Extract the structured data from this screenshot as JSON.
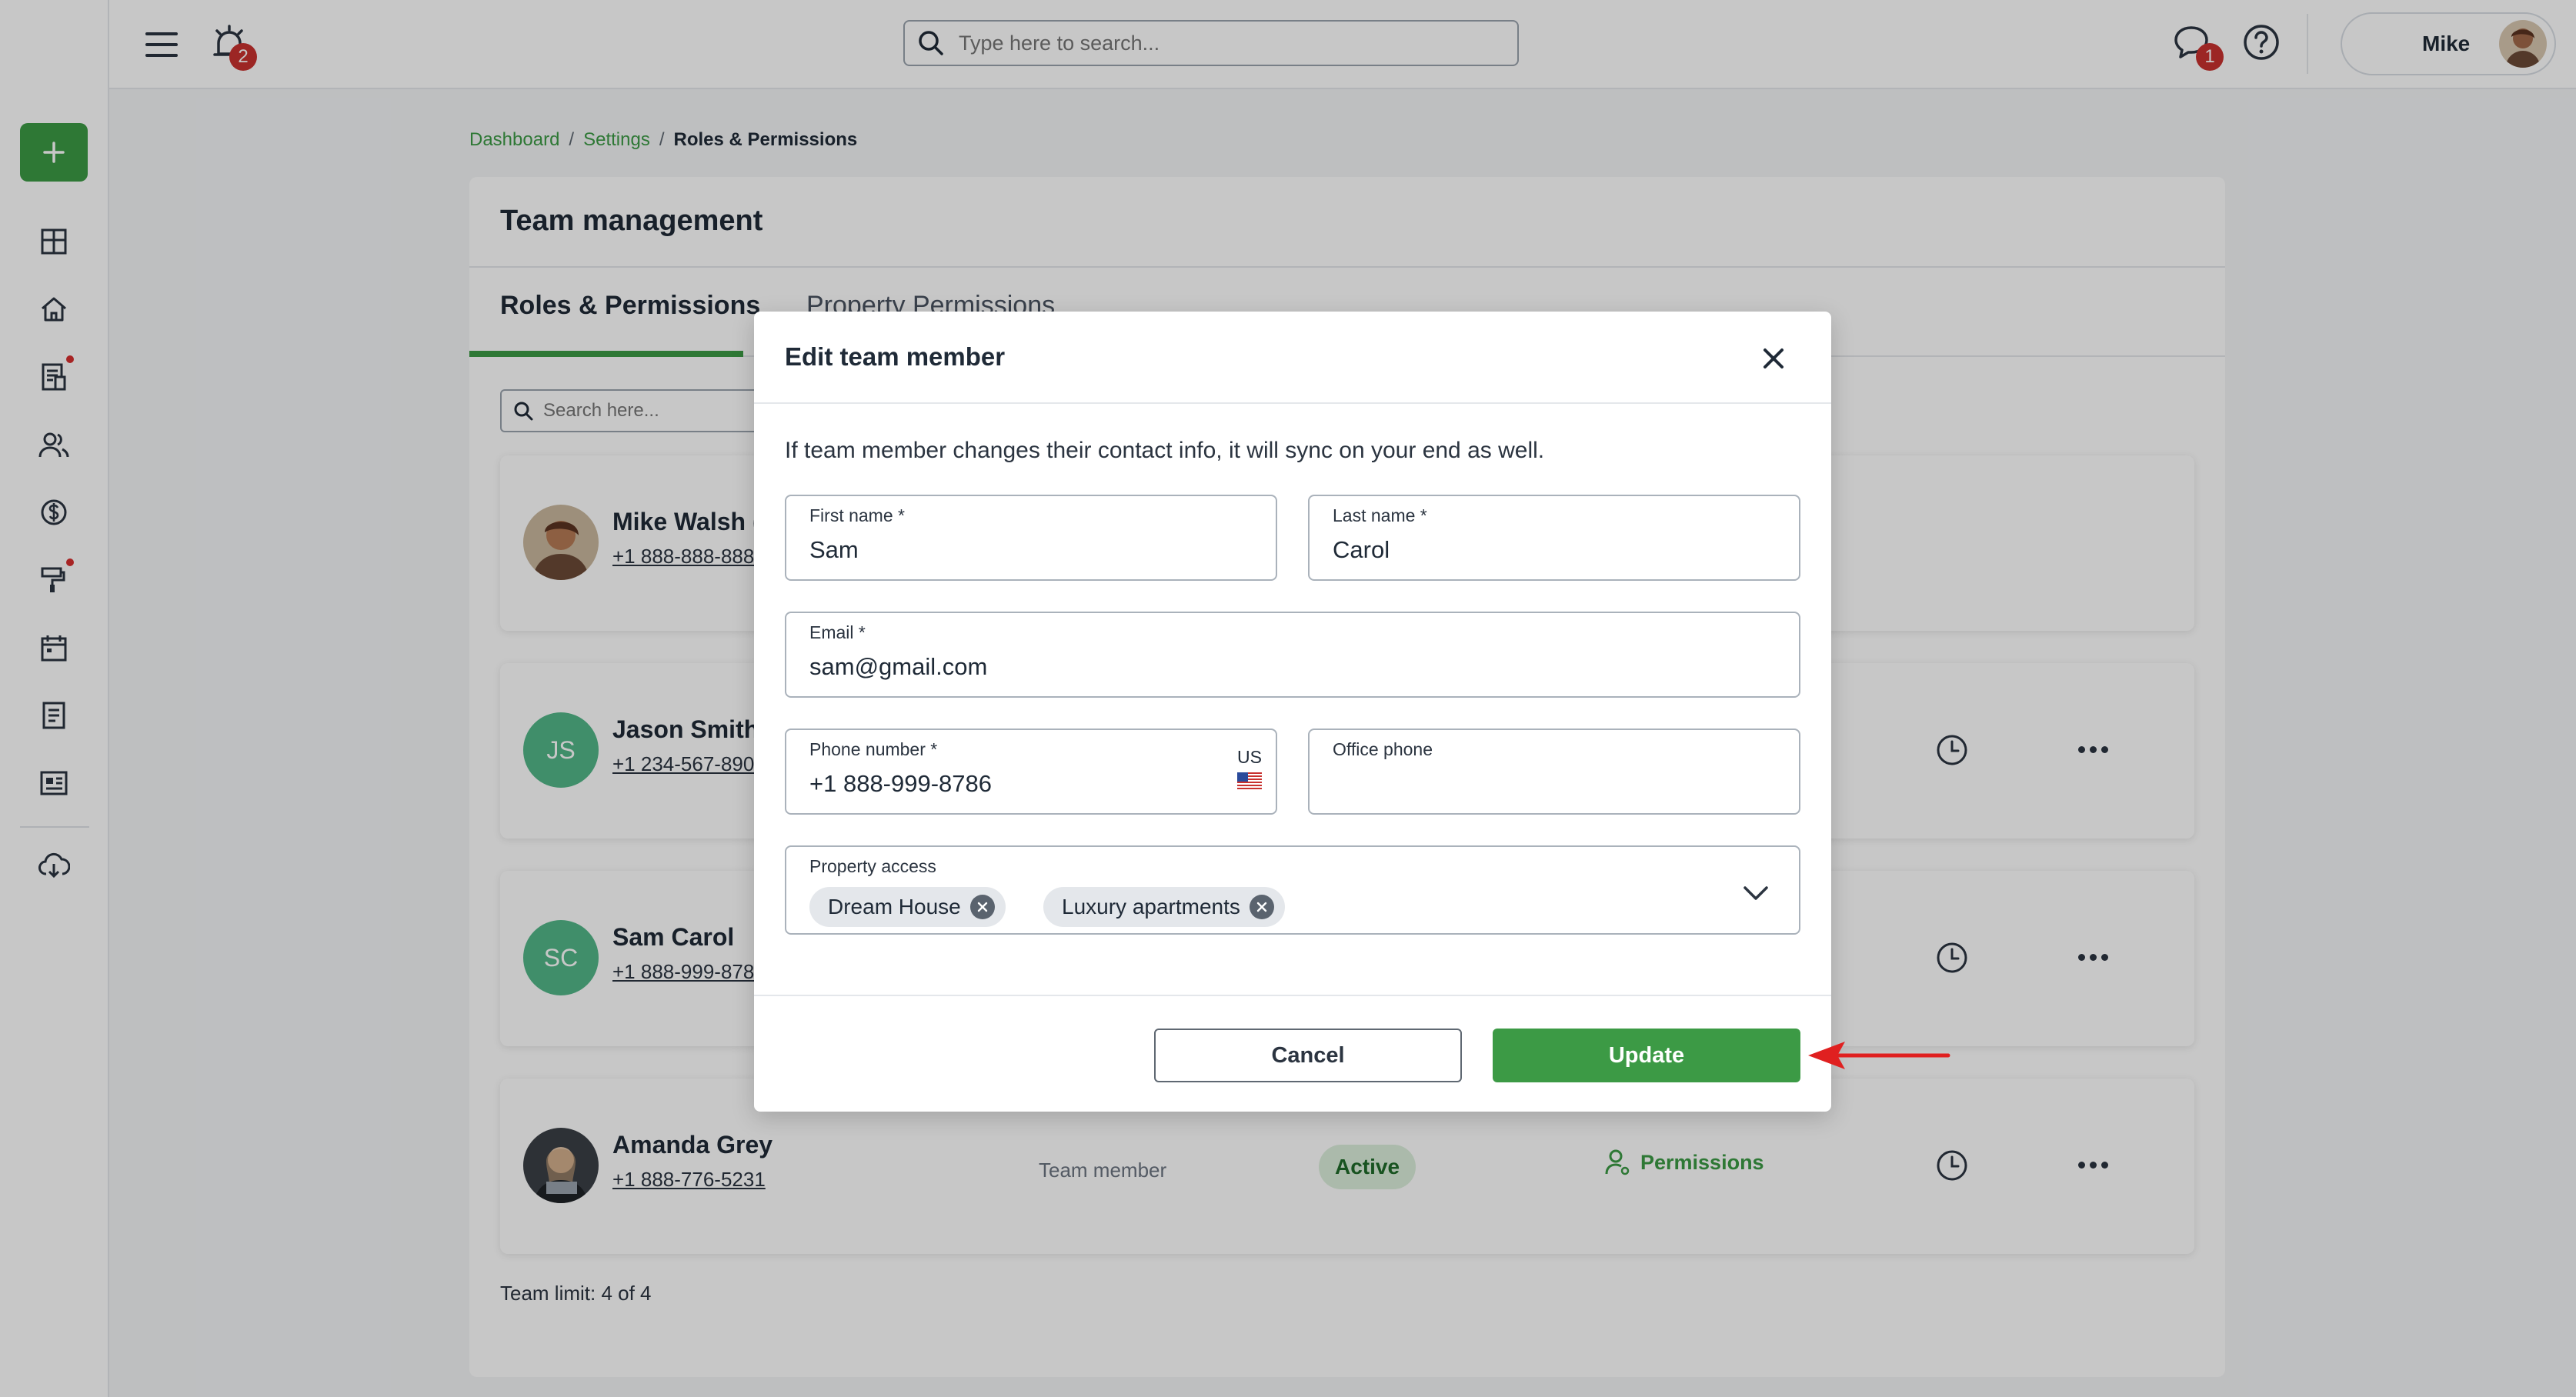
{
  "topbar": {
    "alarm_badge": "2",
    "search_placeholder": "Type here to search...",
    "chat_badge": "1",
    "user_name": "Mike"
  },
  "breadcrumb": {
    "items": [
      "Dashboard",
      "Settings"
    ],
    "current": "Roles & Permissions"
  },
  "panel": {
    "title": "Team management",
    "tabs": [
      {
        "label": "Roles & Permissions",
        "active": true
      },
      {
        "label": "Property Permissions",
        "active": false
      }
    ],
    "search_placeholder": "Search here...",
    "members": [
      {
        "name": "Mike Walsh (",
        "phone": "+1 888-888-888",
        "avatar": "photo"
      },
      {
        "name": "Jason Smith",
        "phone": "+1 234-567-890",
        "initials": "JS"
      },
      {
        "name": "Sam Carol",
        "phone": "+1 888-999-878",
        "initials": "SC"
      },
      {
        "name": "Amanda Grey",
        "phone": "+1 888-776-5231",
        "avatar": "photo",
        "role": "Team member",
        "status": "Active",
        "permissions_label": "Permissions"
      }
    ],
    "team_limit": "Team limit: 4 of 4"
  },
  "modal": {
    "title": "Edit team member",
    "note": "If team member changes their contact info, it will sync on your end as well.",
    "first_name": {
      "label": "First name *",
      "value": "Sam"
    },
    "last_name": {
      "label": "Last name *",
      "value": "Carol"
    },
    "email": {
      "label": "Email *",
      "value": "sam@gmail.com"
    },
    "phone": {
      "label": "Phone number *",
      "value": "+1 888-999-8786",
      "country": "US"
    },
    "office_phone": {
      "label": "Office phone",
      "value": ""
    },
    "property_access": {
      "label": "Property access",
      "chips": [
        "Dream House",
        "Luxury apartments"
      ]
    },
    "cancel_label": "Cancel",
    "update_label": "Update"
  },
  "colors": {
    "accent": "#3c9a45",
    "badge": "#c8312f",
    "avatar_green": "#52b788",
    "arrow": "#e02020"
  },
  "icons": [
    "plus-icon",
    "dashboard-icon",
    "home-icon",
    "document-icon",
    "users-icon",
    "dollar-icon",
    "paint-roller-icon",
    "calendar-icon",
    "notes-icon",
    "listing-icon",
    "cloud-download-icon",
    "menu-icon",
    "alarm-icon",
    "search-icon",
    "chat-icon",
    "help-icon",
    "close-icon",
    "chevron-down-icon",
    "clock-icon",
    "more-icon",
    "user-permissions-icon"
  ]
}
